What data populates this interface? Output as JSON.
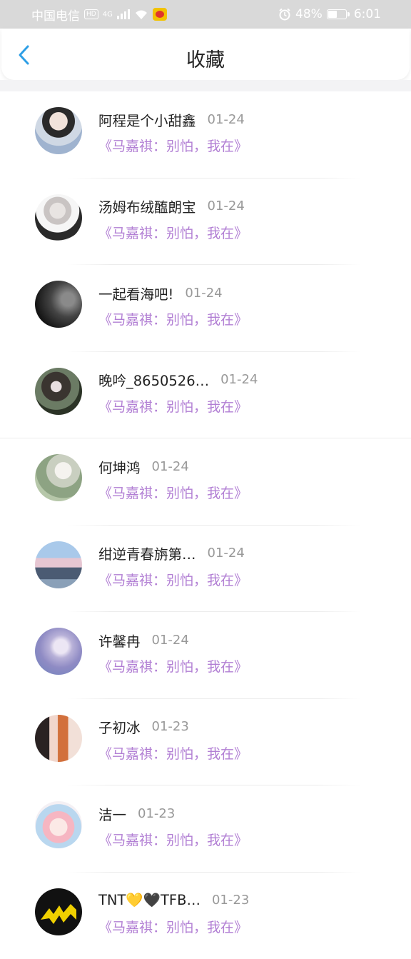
{
  "status_bar": {
    "carrier": "中国电信",
    "hd": "HD",
    "network": "4G",
    "battery": "48%",
    "battery_level": 0.48,
    "time": "6:01"
  },
  "header": {
    "title": "收藏"
  },
  "favorites": [
    {
      "name": "阿程是个小甜鑫",
      "date": "01-24",
      "title": "《马嘉祺：别怕，我在》"
    },
    {
      "name": "汤姆布绒醢朗宝",
      "date": "01-24",
      "title": "《马嘉祺：别怕，我在》"
    },
    {
      "name": "一起看海吧!",
      "date": "01-24",
      "title": "《马嘉祺：别怕，我在》"
    },
    {
      "name": "晚吟_8650526…",
      "date": "01-24",
      "title": "《马嘉祺：别怕，我在》"
    },
    {
      "name": "何坤鸿",
      "date": "01-24",
      "title": "《马嘉祺：别怕，我在》"
    },
    {
      "name": "绀逆青春旃第…",
      "date": "01-24",
      "title": "《马嘉祺：别怕，我在》"
    },
    {
      "name": "许馨冉",
      "date": "01-24",
      "title": "《马嘉祺：别怕，我在》"
    },
    {
      "name": "子初冰",
      "date": "01-23",
      "title": "《马嘉祺：别怕，我在》"
    },
    {
      "name": "洁一",
      "date": "01-23",
      "title": "《马嘉祺：别怕，我在》"
    },
    {
      "name": "TNT💛🖤TFB…",
      "date": "01-23",
      "title": "《马嘉祺：别怕，我在》"
    }
  ],
  "colors": {
    "accent": "#2e9fe6",
    "title_purple": "#b27fd4",
    "date_gray": "#999999"
  }
}
